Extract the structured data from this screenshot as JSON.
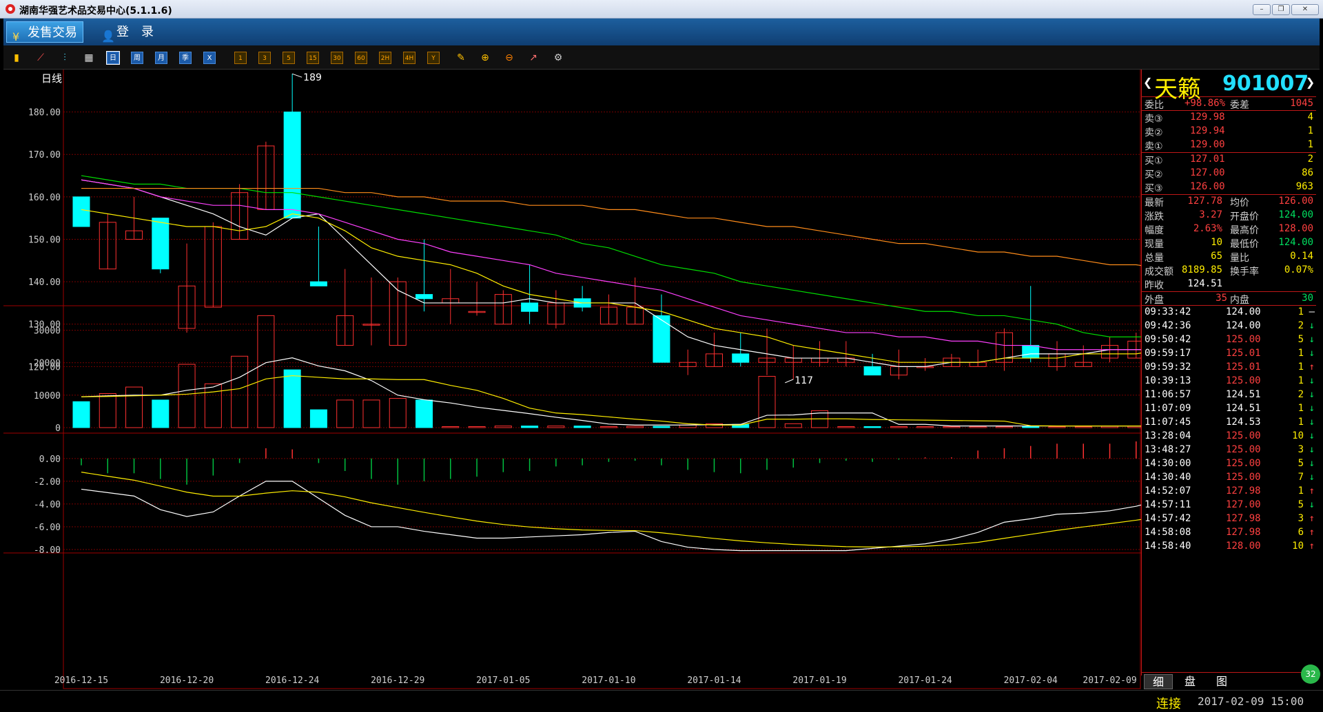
{
  "window": {
    "title": "湖南华强艺术品交易中心(5.1.1.6)"
  },
  "menu": {
    "items": [
      {
        "label": "发售交易",
        "icon": "yen-icon"
      },
      {
        "label": "登　录",
        "icon": "user-icon"
      }
    ]
  },
  "toolbar": {
    "period_buttons": [
      "日",
      "周",
      "月",
      "季",
      "X"
    ],
    "minute_buttons": [
      "1",
      "3",
      "5",
      "15",
      "30",
      "60",
      "2H",
      "4H",
      "Y"
    ]
  },
  "chart_data": {
    "type": "candlestick",
    "period_label": "日线",
    "price_axis": {
      "ticks": [
        "180.00",
        "170.00",
        "160.00",
        "150.00",
        "140.00",
        "130.00",
        "120.00"
      ],
      "range": [
        118.6,
        190
      ]
    },
    "volume_axis": {
      "ticks": [
        "30000",
        "20000",
        "10000",
        "0"
      ],
      "range": [
        0,
        35000
      ]
    },
    "macd_axis": {
      "ticks": [
        "0.00",
        "-2.00",
        "-4.00",
        "-6.00",
        "-8.00"
      ],
      "range": [
        -8,
        1.2
      ]
    },
    "date_labels": [
      "2016-12-15",
      "2016-12-20",
      "2016-12-24",
      "2016-12-29",
      "2017-01-05",
      "2017-01-10",
      "2017-01-14",
      "2017-01-19",
      "2017-01-24",
      "2017-02-04",
      "2017-02-09"
    ],
    "date_label_index": [
      0,
      4,
      8,
      12,
      16,
      20,
      24,
      28,
      32,
      36,
      39
    ],
    "high_mark": "189",
    "low_mark": "117",
    "candles": [
      {
        "o": 160,
        "c": 153,
        "h": 160,
        "l": 153
      },
      {
        "o": 143,
        "c": 154,
        "h": 156,
        "l": 143
      },
      {
        "o": 150,
        "c": 152,
        "h": 160,
        "l": 150
      },
      {
        "o": 155,
        "c": 143,
        "h": 155,
        "l": 142
      },
      {
        "o": 129,
        "c": 139,
        "h": 149,
        "l": 128
      },
      {
        "o": 134,
        "c": 153,
        "h": 154,
        "l": 134
      },
      {
        "o": 150,
        "c": 161,
        "h": 163,
        "l": 150
      },
      {
        "o": 157,
        "c": 172,
        "h": 173,
        "l": 157
      },
      {
        "o": 180,
        "c": 155,
        "h": 189,
        "l": 155
      },
      {
        "o": 140,
        "c": 139,
        "h": 153,
        "l": 139
      },
      {
        "o": 125,
        "c": 132,
        "h": 143,
        "l": 125
      },
      {
        "o": 130,
        "c": 130,
        "h": 141,
        "l": 125
      },
      {
        "o": 125,
        "c": 140,
        "h": 141,
        "l": 125
      },
      {
        "o": 137,
        "c": 136,
        "h": 150,
        "l": 133
      },
      {
        "o": 135,
        "c": 136,
        "h": 143,
        "l": 130
      },
      {
        "o": 133,
        "c": 133,
        "h": 140,
        "l": 132
      },
      {
        "o": 130,
        "c": 137,
        "h": 138,
        "l": 130
      },
      {
        "o": 135,
        "c": 133,
        "h": 144,
        "l": 130
      },
      {
        "o": 130,
        "c": 135,
        "h": 138,
        "l": 129
      },
      {
        "o": 136,
        "c": 134,
        "h": 139,
        "l": 133
      },
      {
        "o": 130,
        "c": 134,
        "h": 137,
        "l": 130
      },
      {
        "o": 130,
        "c": 134,
        "h": 141,
        "l": 130
      },
      {
        "o": 132,
        "c": 121,
        "h": 137,
        "l": 121
      },
      {
        "o": 120,
        "c": 121,
        "h": 124,
        "l": 118
      },
      {
        "o": 120,
        "c": 123,
        "h": 128,
        "l": 120
      },
      {
        "o": 123,
        "c": 121,
        "h": 128,
        "l": 120
      },
      {
        "o": 121,
        "c": 122,
        "h": 129,
        "l": 118
      },
      {
        "o": 121,
        "c": 122,
        "h": 125,
        "l": 117
      },
      {
        "o": 121,
        "c": 122,
        "h": 126,
        "l": 120
      },
      {
        "o": 121,
        "c": 122,
        "h": 126,
        "l": 120
      },
      {
        "o": 120,
        "c": 118,
        "h": 123,
        "l": 118
      },
      {
        "o": 118,
        "c": 120,
        "h": 124,
        "l": 117
      },
      {
        "o": 120,
        "c": 120,
        "h": 122,
        "l": 119
      },
      {
        "o": 120,
        "c": 122,
        "h": 123,
        "l": 120
      },
      {
        "o": 120,
        "c": 121,
        "h": 124,
        "l": 120
      },
      {
        "o": 121,
        "c": 128,
        "h": 129,
        "l": 119
      },
      {
        "o": 125,
        "c": 122,
        "h": 139,
        "l": 121
      },
      {
        "o": 120,
        "c": 123,
        "h": 126,
        "l": 119
      },
      {
        "o": 120,
        "c": 121,
        "h": 125,
        "l": 120
      },
      {
        "o": 122,
        "c": 125,
        "h": 127,
        "l": 121
      },
      {
        "o": 122,
        "c": 126,
        "h": 128,
        "l": 122
      },
      {
        "o": 124,
        "c": 128,
        "h": 128,
        "l": 124
      }
    ],
    "ma": [
      {
        "color": "#ffffff",
        "values": [
          164,
          163,
          162,
          160,
          158,
          156,
          153,
          151,
          155,
          156,
          150,
          144,
          138,
          135,
          135,
          135,
          135,
          136,
          135,
          135,
          135,
          135,
          131,
          127,
          125,
          124,
          123,
          122,
          122,
          122,
          121,
          120,
          120,
          121,
          121,
          122,
          123,
          123,
          123,
          124,
          124,
          124
        ]
      },
      {
        "color": "#ffee00",
        "values": [
          157,
          156,
          155,
          154,
          153,
          153,
          152,
          153,
          156,
          155,
          152,
          148,
          146,
          145,
          144,
          142,
          139,
          137,
          136,
          135,
          135,
          134,
          133,
          131,
          129,
          128,
          127,
          125,
          124,
          123,
          122,
          121,
          121,
          121,
          121,
          122,
          122,
          122,
          123,
          123,
          123,
          124
        ]
      },
      {
        "color": "#ff40ff",
        "values": [
          164,
          163,
          162,
          160,
          159,
          158,
          158,
          157,
          157,
          156,
          154,
          152,
          150,
          149,
          147,
          146,
          145,
          144,
          142,
          141,
          140,
          139,
          138,
          136,
          134,
          132,
          131,
          130,
          129,
          128,
          128,
          127,
          127,
          126,
          126,
          125,
          125,
          124,
          124,
          124,
          124,
          124
        ]
      },
      {
        "color": "#00dd00",
        "values": [
          165,
          164,
          163,
          163,
          162,
          162,
          162,
          161,
          161,
          160,
          159,
          158,
          157,
          156,
          155,
          154,
          153,
          152,
          151,
          149,
          148,
          146,
          144,
          143,
          142,
          140,
          139,
          138,
          137,
          136,
          135,
          134,
          133,
          133,
          132,
          132,
          131,
          130,
          128,
          127,
          127,
          127
        ]
      },
      {
        "color": "#ff8c1a",
        "values": [
          162,
          162,
          162,
          162,
          162,
          162,
          162,
          162,
          162,
          162,
          161,
          161,
          160,
          160,
          159,
          159,
          159,
          158,
          158,
          158,
          157,
          157,
          156,
          155,
          155,
          154,
          153,
          153,
          152,
          151,
          150,
          149,
          149,
          148,
          147,
          147,
          146,
          146,
          145,
          144,
          144,
          143
        ]
      }
    ],
    "volume": [
      8000,
      10500,
      12500,
      8500,
      19500,
      13500,
      22000,
      34500,
      17800,
      5500,
      8500,
      8500,
      9000,
      8500,
      0,
      0,
      500,
      500,
      500,
      500,
      300,
      400,
      400,
      800,
      1200,
      1000,
      15800,
      1200,
      5200,
      300,
      200,
      200,
      200,
      200,
      200,
      200,
      200,
      300,
      300,
      400,
      400,
      400
    ],
    "vol_ma": [
      {
        "color": "#ffffff",
        "values": [
          9500,
          9800,
          10000,
          10000,
          11500,
          12500,
          15500,
          20000,
          21500,
          19000,
          17500,
          14500,
          10000,
          8600,
          7600,
          6300,
          5300,
          4300,
          3200,
          2200,
          1100,
          800,
          800,
          800,
          900,
          1000,
          3800,
          3900,
          4500,
          4500,
          4500,
          1000,
          1000,
          500,
          500,
          500,
          500,
          500,
          500,
          500,
          500,
          500
        ]
      },
      {
        "color": "#ffee00",
        "values": [
          9500,
          9600,
          9800,
          10000,
          10300,
          11000,
          12000,
          15000,
          16000,
          15500,
          15000,
          15000,
          14800,
          14800,
          13000,
          11500,
          9000,
          6000,
          4500,
          4000,
          3300,
          2600,
          2000,
          1200,
          800,
          800,
          2600,
          2600,
          2700,
          2700,
          2500,
          2400,
          2300,
          2200,
          2100,
          2000,
          600,
          500,
          500,
          500,
          500,
          500
        ]
      }
    ],
    "macd_hist": [
      -0.6,
      -1.3,
      -1.3,
      -1.8,
      -2.3,
      -1.5,
      -0.4,
      0.9,
      0.8,
      -0.4,
      -1.1,
      -1.8,
      -2.3,
      -2.0,
      -1.8,
      -1.6,
      -1.2,
      -1.1,
      -0.7,
      -0.6,
      -0.3,
      -0.2,
      -0.6,
      -1.0,
      -1.2,
      -1.3,
      -1.0,
      -0.8,
      -0.4,
      -0.2,
      -0.3,
      -0.1,
      0.1,
      0.1,
      0.7,
      0.9,
      1.1,
      1.3,
      1.3,
      1.3,
      1.5,
      1.5
    ],
    "dif": [
      -2.7,
      -3.0,
      -3.3,
      -4.5,
      -5.1,
      -4.7,
      -3.3,
      -2.0,
      -2.0,
      -3.5,
      -5.0,
      -6.0,
      -6.0,
      -6.4,
      -6.7,
      -7.0,
      -7.0,
      -6.9,
      -6.8,
      -6.7,
      -6.5,
      -6.4,
      -7.3,
      -7.8,
      -8.0,
      -8.1,
      -8.1,
      -8.1,
      -8.1,
      -8.1,
      -7.9,
      -7.7,
      -7.5,
      -7.1,
      -6.5,
      -5.6,
      -5.3,
      -4.9,
      -4.8,
      -4.6,
      -4.2,
      -3.6
    ]
  },
  "quote": {
    "name": "天籁",
    "code": "901007",
    "weibi": {
      "label": "委比",
      "value": "+98.86%"
    },
    "weicha": {
      "label": "委差",
      "value": "1045"
    },
    "asks": [
      {
        "label": "卖③",
        "price": "129.98",
        "qty": "4"
      },
      {
        "label": "卖②",
        "price": "129.94",
        "qty": "1"
      },
      {
        "label": "卖①",
        "price": "129.00",
        "qty": "1"
      }
    ],
    "bids": [
      {
        "label": "买①",
        "price": "127.01",
        "qty": "2"
      },
      {
        "label": "买②",
        "price": "127.00",
        "qty": "86"
      },
      {
        "label": "买③",
        "price": "126.00",
        "qty": "963"
      }
    ],
    "stats": [
      {
        "l1": "最新",
        "v1": "127.78",
        "l2": "均价",
        "v2": "126.00"
      },
      {
        "l1": "涨跌",
        "v1": "3.27",
        "l2": "开盘价",
        "v2": "124.00"
      },
      {
        "l1": "幅度",
        "v1": "2.63%",
        "l2": "最高价",
        "v2": "128.00"
      },
      {
        "l1": "现量",
        "v1": "10",
        "l2": "最低价",
        "v2": "124.00"
      },
      {
        "l1": "总量",
        "v1": "65",
        "l2": "量比",
        "v2": "0.14"
      },
      {
        "l1": "成交额",
        "v1": "8189.85",
        "l2": "换手率",
        "v2": "0.07%"
      },
      {
        "l1": "昨收",
        "v1": "124.51",
        "l2": "",
        "v2": ""
      }
    ],
    "waipan": {
      "label": "外盘",
      "value": "35"
    },
    "neipan": {
      "label": "内盘",
      "value": "30"
    },
    "ticks": [
      {
        "time": "09:33:42",
        "price": "124.00",
        "qty": "1",
        "dir": "–"
      },
      {
        "time": "09:42:36",
        "price": "124.00",
        "qty": "2",
        "dir": "↓"
      },
      {
        "time": "09:50:42",
        "price": "125.00",
        "qty": "5",
        "dir": "↓"
      },
      {
        "time": "09:59:17",
        "price": "125.01",
        "qty": "1",
        "dir": "↓"
      },
      {
        "time": "09:59:32",
        "price": "125.01",
        "qty": "1",
        "dir": "↑"
      },
      {
        "time": "10:39:13",
        "price": "125.00",
        "qty": "1",
        "dir": "↓"
      },
      {
        "time": "11:06:57",
        "price": "124.51",
        "qty": "2",
        "dir": "↓"
      },
      {
        "time": "11:07:09",
        "price": "124.51",
        "qty": "1",
        "dir": "↓"
      },
      {
        "time": "11:07:45",
        "price": "124.53",
        "qty": "1",
        "dir": "↓"
      },
      {
        "time": "13:28:04",
        "price": "125.00",
        "qty": "10",
        "dir": "↓"
      },
      {
        "time": "13:48:27",
        "price": "125.00",
        "qty": "3",
        "dir": "↓"
      },
      {
        "time": "14:30:00",
        "price": "125.00",
        "qty": "5",
        "dir": "↓"
      },
      {
        "time": "14:30:40",
        "price": "125.00",
        "qty": "7",
        "dir": "↓"
      },
      {
        "time": "14:52:07",
        "price": "127.98",
        "qty": "1",
        "dir": "↑"
      },
      {
        "time": "14:57:11",
        "price": "127.00",
        "qty": "5",
        "dir": "↓"
      },
      {
        "time": "14:57:42",
        "price": "127.98",
        "qty": "3",
        "dir": "↑"
      },
      {
        "time": "14:58:08",
        "price": "127.98",
        "qty": "6",
        "dir": "↑"
      },
      {
        "time": "14:58:40",
        "price": "128.00",
        "qty": "10",
        "dir": "↑"
      }
    ],
    "tabs": [
      "细",
      "盘",
      "图"
    ]
  },
  "status": {
    "connection": "连接",
    "datetime": "2017-02-09  15:00",
    "badge": "32"
  },
  "colors": {
    "up": "#ff3030",
    "down": "#00ffff",
    "grid": "#8b0000",
    "axis_text": "#d0d0d0"
  }
}
